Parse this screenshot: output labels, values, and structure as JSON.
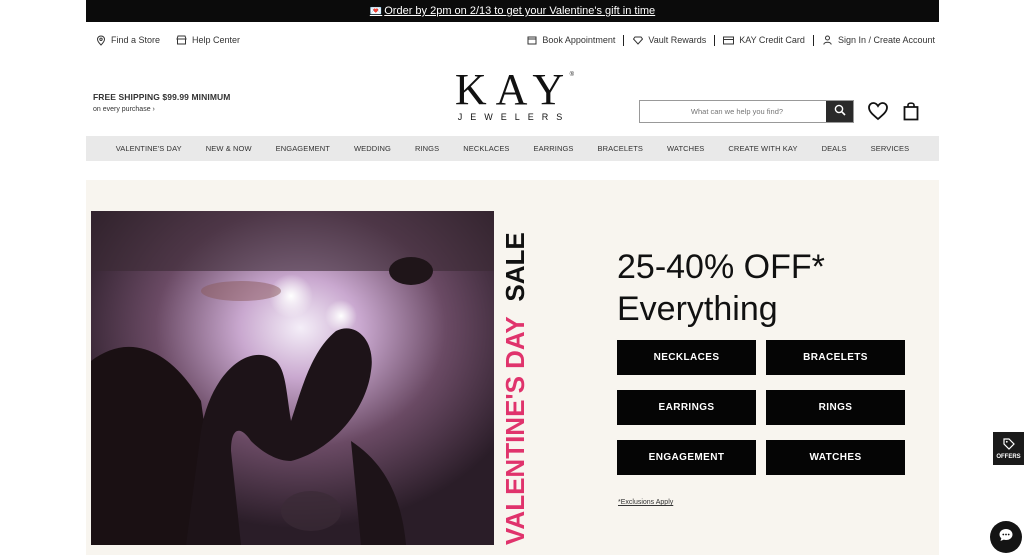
{
  "promo_bar": {
    "text": "Order by 2pm on 2/13 to get your Valentine's gift in time"
  },
  "utility": {
    "left": [
      "Find a Store",
      "Help Center"
    ],
    "right": [
      "Book Appointment",
      "Vault Rewards",
      "KAY Credit Card",
      "Sign In / Create Account"
    ]
  },
  "shipping": {
    "title": "FREE SHIPPING $99.99 MINIMUM",
    "subtitle": "on every purchase ›"
  },
  "logo": {
    "main": "KAY",
    "sub": "JEWELERS",
    "reg": "®"
  },
  "search": {
    "placeholder": "What can we help you find?"
  },
  "nav": [
    "VALENTINE'S DAY",
    "NEW & NOW",
    "ENGAGEMENT",
    "WEDDING",
    "RINGS",
    "NECKLACES",
    "EARRINGS",
    "BRACELETS",
    "WATCHES",
    "CREATE WITH KAY",
    "DEALS",
    "SERVICES"
  ],
  "hero": {
    "vertical_part1": "VALENTINE'S DAY",
    "vertical_part2": "SALE",
    "headline_line1": "25-40% OFF*",
    "headline_line2": "Everything",
    "categories": [
      "NECKLACES",
      "BRACELETS",
      "EARRINGS",
      "RINGS",
      "ENGAGEMENT",
      "WATCHES"
    ],
    "exclusions": "*Exclusions Apply"
  },
  "offers_label": "OFFERS",
  "colors": {
    "accent_pink": "#e0336c",
    "dark": "#0b0b0b",
    "hero_bg": "#f8f5ef",
    "nav_bg": "#e9e9e9"
  }
}
